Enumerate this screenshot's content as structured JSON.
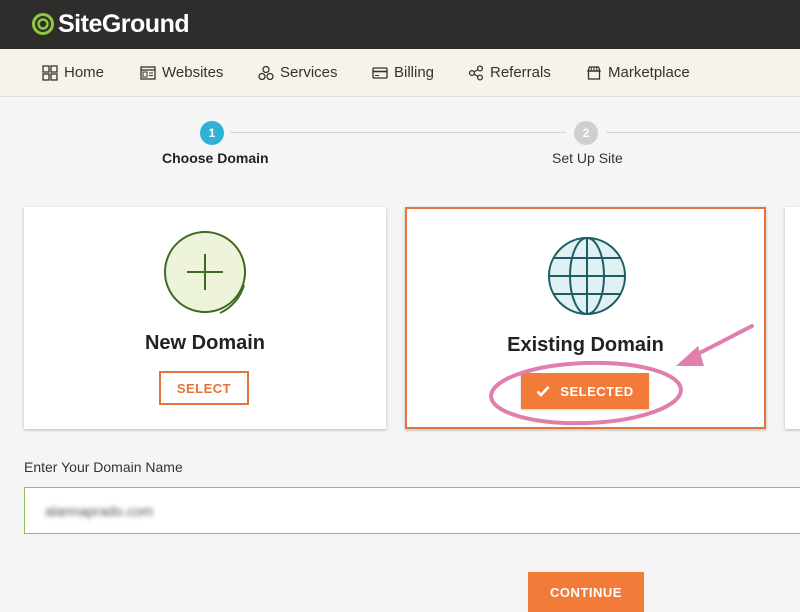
{
  "brand": {
    "name": "SiteGround"
  },
  "nav": {
    "items": [
      {
        "label": "Home",
        "icon": "grid-icon"
      },
      {
        "label": "Websites",
        "icon": "websites-icon"
      },
      {
        "label": "Services",
        "icon": "services-icon"
      },
      {
        "label": "Billing",
        "icon": "credit-card-icon"
      },
      {
        "label": "Referrals",
        "icon": "share-icon"
      },
      {
        "label": "Marketplace",
        "icon": "store-icon"
      }
    ]
  },
  "steps": [
    {
      "number": "1",
      "label": "Choose Domain",
      "active": true
    },
    {
      "number": "2",
      "label": "Set Up Site",
      "active": false
    }
  ],
  "options": {
    "new_domain": {
      "title": "New Domain",
      "button": "SELECT",
      "icon": "plus-circle-icon"
    },
    "existing_domain": {
      "title": "Existing Domain",
      "button": "SELECTED",
      "icon": "globe-icon",
      "selected": true
    }
  },
  "domain_input": {
    "label": "Enter Your Domain Name",
    "value": "alannaprado.com"
  },
  "continue_button": "CONTINUE",
  "colors": {
    "accent": "#f27b3a",
    "step_active": "#2eb3d6",
    "step_inactive": "#cfcfcf",
    "annotation": "#e07fae",
    "globe": "#1e5c66",
    "plus": "#3f6b21"
  }
}
